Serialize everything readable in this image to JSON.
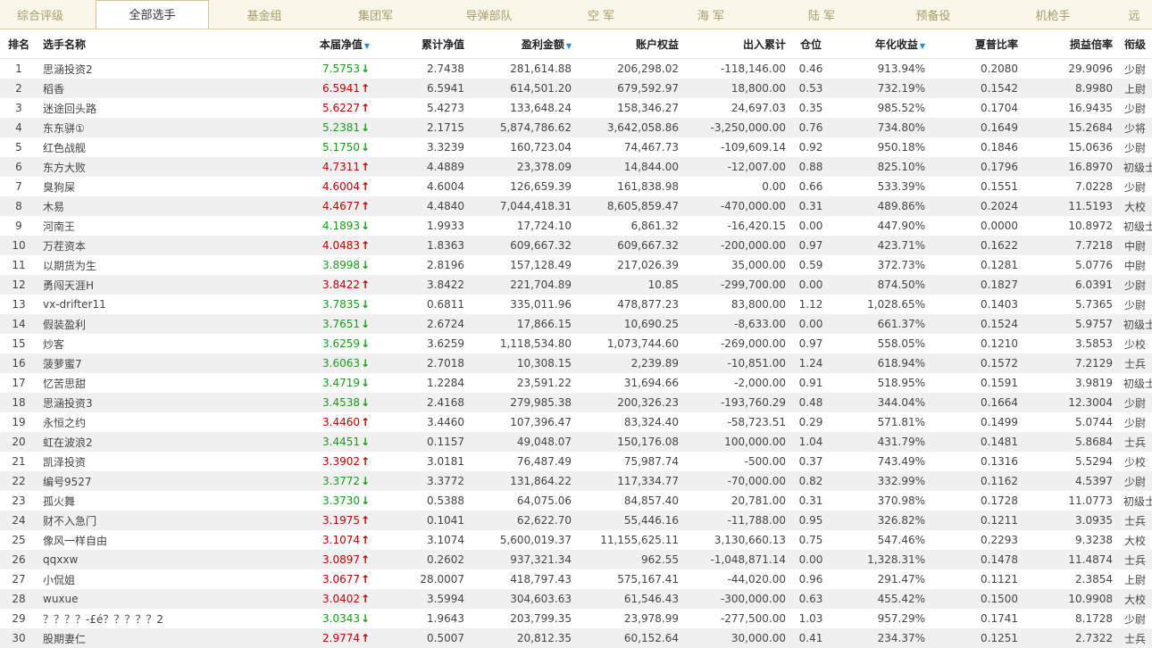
{
  "tabs": [
    {
      "label": "综合评级",
      "active": false
    },
    {
      "label": "全部选手",
      "active": true
    },
    {
      "label": "基金组",
      "active": false
    },
    {
      "label": "集团军",
      "active": false
    },
    {
      "label": "导弹部队",
      "active": false
    },
    {
      "label": "空  军",
      "active": false
    },
    {
      "label": "海  军",
      "active": false
    },
    {
      "label": "陆  军",
      "active": false
    },
    {
      "label": "预备役",
      "active": false
    },
    {
      "label": "机枪手",
      "active": false
    },
    {
      "label": "远",
      "active": false
    }
  ],
  "headers": {
    "rank": "排名",
    "name": "选手名称",
    "nav": "本届净值",
    "cum": "累计净值",
    "profit": "盈利金额",
    "equity": "账户权益",
    "flow": "出入累计",
    "pos": "仓位",
    "annual": "年化收益",
    "sharpe": "夏普比率",
    "pl": "损益倍率",
    "grade": "衔级",
    "sort_icon": "▼"
  },
  "rows": [
    [
      "1",
      "思涵投资2",
      "7.5753",
      "down",
      "2.7438",
      "281,614.88",
      "206,298.02",
      "-118,146.00",
      "0.46",
      "913.94%",
      "0.2080",
      "29.9096",
      "少尉"
    ],
    [
      "2",
      "稻香",
      "6.5941",
      "up",
      "6.5941",
      "614,501.20",
      "679,592.97",
      "18,800.00",
      "0.53",
      "732.19%",
      "0.1542",
      "8.9980",
      "上尉"
    ],
    [
      "3",
      "迷途回头路",
      "5.6227",
      "up",
      "5.4273",
      "133,648.24",
      "158,346.27",
      "24,697.03",
      "0.35",
      "985.52%",
      "0.1704",
      "16.9435",
      "少尉"
    ],
    [
      "4",
      "东东骈①",
      "5.2381",
      "down",
      "2.1715",
      "5,874,786.62",
      "3,642,058.86",
      "-3,250,000.00",
      "0.76",
      "734.80%",
      "0.1649",
      "15.2684",
      "少将"
    ],
    [
      "5",
      "红色战舰",
      "5.1750",
      "down",
      "3.3239",
      "160,723.04",
      "74,467.73",
      "-109,609.14",
      "0.92",
      "950.18%",
      "0.1846",
      "15.0636",
      "少尉"
    ],
    [
      "6",
      "东方大败",
      "4.7311",
      "up",
      "4.4889",
      "23,378.09",
      "14,844.00",
      "-12,007.00",
      "0.88",
      "825.10%",
      "0.1796",
      "16.8970",
      "初级士官"
    ],
    [
      "7",
      "臭狗屎",
      "4.6004",
      "up",
      "4.6004",
      "126,659.39",
      "161,838.98",
      "0.00",
      "0.66",
      "533.39%",
      "0.1551",
      "7.0228",
      "少尉"
    ],
    [
      "8",
      "木易",
      "4.4677",
      "up",
      "4.4840",
      "7,044,418.31",
      "8,605,859.47",
      "-470,000.00",
      "0.31",
      "489.86%",
      "0.2024",
      "11.5193",
      "大校"
    ],
    [
      "9",
      "河南王",
      "4.1893",
      "down",
      "1.9933",
      "17,724.10",
      "6,861.32",
      "-16,420.15",
      "0.00",
      "447.90%",
      "0.0000",
      "10.8972",
      "初级士官"
    ],
    [
      "10",
      "万茬资本",
      "4.0483",
      "up",
      "1.8363",
      "609,667.32",
      "609,667.32",
      "-200,000.00",
      "0.97",
      "423.71%",
      "0.1622",
      "7.7218",
      "中尉"
    ],
    [
      "11",
      "以期货为生",
      "3.8998",
      "down",
      "2.8196",
      "157,128.49",
      "217,026.39",
      "35,000.00",
      "0.59",
      "372.73%",
      "0.1281",
      "5.0776",
      "中尉"
    ],
    [
      "12",
      "勇闯天涯H",
      "3.8422",
      "up",
      "3.8422",
      "221,704.89",
      "10.85",
      "-299,700.00",
      "0.00",
      "874.50%",
      "0.1827",
      "6.0391",
      "少尉"
    ],
    [
      "13",
      "vx-drifter11",
      "3.7835",
      "down",
      "0.6811",
      "335,011.96",
      "478,877.23",
      "83,800.00",
      "1.12",
      "1,028.65%",
      "0.1403",
      "5.7365",
      "少尉"
    ],
    [
      "14",
      "假装盈利",
      "3.7651",
      "down",
      "2.6724",
      "17,866.15",
      "10,690.25",
      "-8,633.00",
      "0.00",
      "661.37%",
      "0.1524",
      "5.9757",
      "初级士官"
    ],
    [
      "15",
      "炒客",
      "3.6259",
      "down",
      "3.6259",
      "1,118,534.80",
      "1,073,744.60",
      "-269,000.00",
      "0.97",
      "558.05%",
      "0.1210",
      "3.5853",
      "少校"
    ],
    [
      "16",
      "菠萝蜜7",
      "3.6063",
      "down",
      "2.7018",
      "10,308.15",
      "2,239.89",
      "-10,851.00",
      "1.24",
      "618.94%",
      "0.1572",
      "7.2129",
      "士兵"
    ],
    [
      "17",
      "忆苦思甜",
      "3.4719",
      "down",
      "1.2284",
      "23,591.22",
      "31,694.66",
      "-2,000.00",
      "0.91",
      "518.95%",
      "0.1591",
      "3.9819",
      "初级士官"
    ],
    [
      "18",
      "思涵投资3",
      "3.4538",
      "down",
      "2.4168",
      "279,985.38",
      "200,326.23",
      "-193,760.29",
      "0.48",
      "344.04%",
      "0.1664",
      "12.3004",
      "少尉"
    ],
    [
      "19",
      "永恒之约",
      "3.4460",
      "up",
      "3.4460",
      "107,396.47",
      "83,324.40",
      "-58,723.51",
      "0.29",
      "571.81%",
      "0.1499",
      "5.0744",
      "少尉"
    ],
    [
      "20",
      "虹在波浪2",
      "3.4451",
      "down",
      "0.1157",
      "49,048.07",
      "150,176.08",
      "100,000.00",
      "1.04",
      "431.79%",
      "0.1481",
      "5.8684",
      "士兵"
    ],
    [
      "21",
      "凯泽投资",
      "3.3902",
      "up",
      "3.0181",
      "76,487.49",
      "75,987.74",
      "-500.00",
      "0.37",
      "743.49%",
      "0.1316",
      "5.5294",
      "少校"
    ],
    [
      "22",
      "编号9527",
      "3.3772",
      "down",
      "3.3772",
      "131,864.22",
      "117,334.77",
      "-70,000.00",
      "0.82",
      "332.99%",
      "0.1162",
      "4.5397",
      "少尉"
    ],
    [
      "23",
      "孤火舞",
      "3.3730",
      "down",
      "0.5388",
      "64,075.06",
      "84,857.40",
      "20,781.00",
      "0.31",
      "370.98%",
      "0.1728",
      "11.0773",
      "初级士官"
    ],
    [
      "24",
      "财不入急门",
      "3.1975",
      "up",
      "0.1041",
      "62,622.70",
      "55,446.16",
      "-11,788.00",
      "0.95",
      "326.82%",
      "0.1211",
      "3.0935",
      "士兵"
    ],
    [
      "25",
      "像风一样自由",
      "3.1074",
      "up",
      "3.1074",
      "5,600,019.37",
      "11,155,625.11",
      "3,130,660.13",
      "0.75",
      "547.46%",
      "0.2293",
      "9.3238",
      "大校"
    ],
    [
      "26",
      "qqxxw",
      "3.0897",
      "up",
      "0.2602",
      "937,321.34",
      "962.55",
      "-1,048,871.14",
      "0.00",
      "1,328.31%",
      "0.1478",
      "11.4874",
      "士兵"
    ],
    [
      "27",
      "小侃姐",
      "3.0677",
      "up",
      "28.0007",
      "418,797.43",
      "575,167.41",
      "-44,020.00",
      "0.96",
      "291.47%",
      "0.1121",
      "2.3854",
      "上尉"
    ],
    [
      "28",
      "wuxue",
      "3.0402",
      "up",
      "3.5994",
      "304,603.63",
      "61,546.43",
      "-300,000.00",
      "0.63",
      "455.42%",
      "0.1500",
      "10.9908",
      "大校"
    ],
    [
      "29",
      "？？？？-£é？？？？？2",
      "3.0343",
      "down",
      "1.9643",
      "203,799.35",
      "23,978.99",
      "-277,500.00",
      "1.03",
      "957.29%",
      "0.1741",
      "8.1728",
      "少尉"
    ],
    [
      "30",
      "股期妻仁",
      "2.9774",
      "up",
      "0.5007",
      "20,812.35",
      "60,152.64",
      "30,000.00",
      "0.41",
      "234.37%",
      "0.1251",
      "2.7322",
      "士兵"
    ]
  ],
  "icons": {
    "up": "arrow-up-icon",
    "down": "arrow-down-icon"
  },
  "colors": {
    "up": "#c00000",
    "down": "#1a9b1a",
    "sort": "#2a8bd0"
  }
}
